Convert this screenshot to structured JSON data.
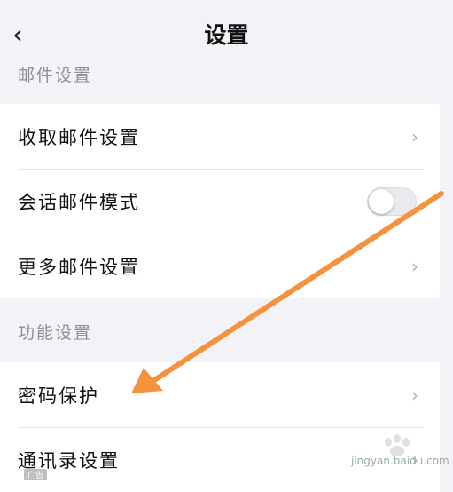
{
  "header": {
    "title": "设置",
    "back_icon": "chevron-left-icon"
  },
  "sections": [
    {
      "label": "邮件设置",
      "items": [
        {
          "label": "收取邮件设置",
          "control": "chevron"
        },
        {
          "label": "会话邮件模式",
          "control": "toggle",
          "toggle_on": false
        },
        {
          "label": "更多邮件设置",
          "control": "chevron"
        }
      ]
    },
    {
      "label": "功能设置",
      "items": [
        {
          "label": "密码保护",
          "control": "chevron"
        },
        {
          "label": "通讯录设置",
          "control": "chevron"
        }
      ]
    }
  ],
  "chevron_glyph": "›",
  "colors": {
    "accent_arrow": "#f5923e",
    "background": "#f2f2f7"
  },
  "watermark": {
    "text": "jingyan.baidu.com",
    "badge": "广告"
  }
}
